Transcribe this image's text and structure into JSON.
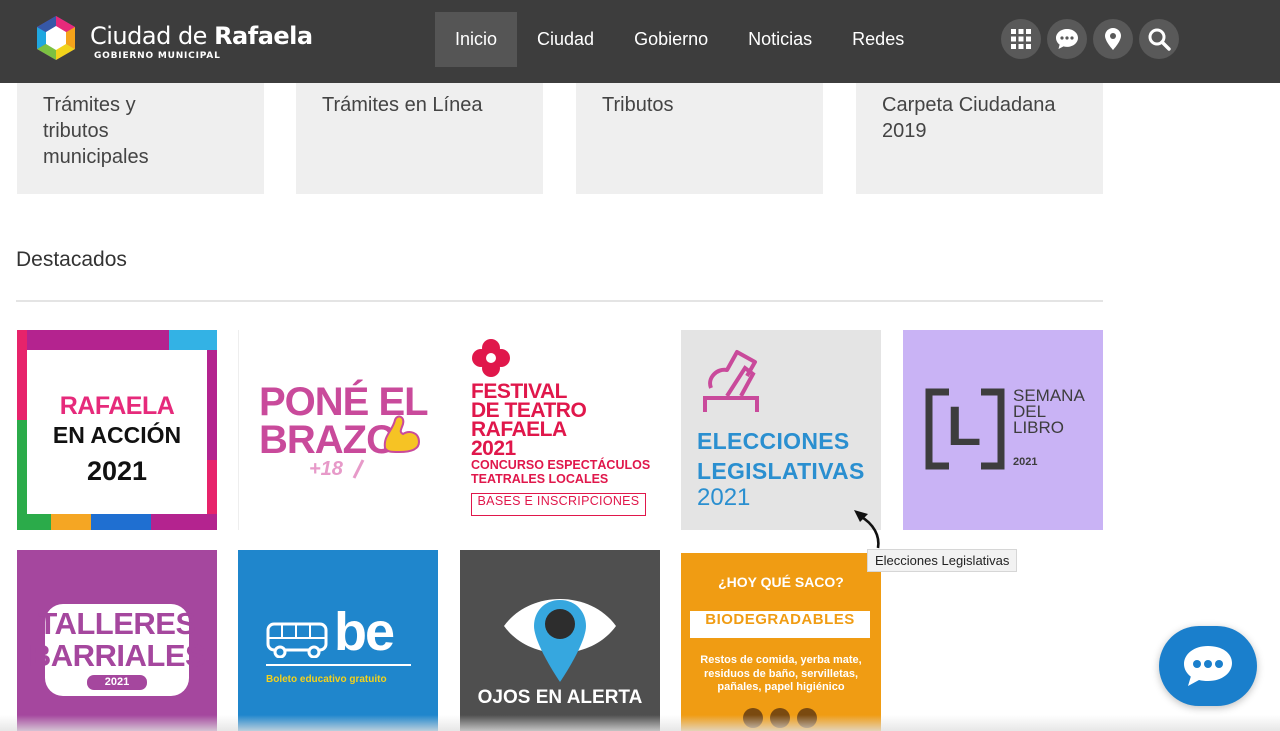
{
  "header": {
    "brand_line1_a": "Ciudad de ",
    "brand_line1_b": "Rafaela",
    "brand_line2": "GOBIERNO MUNICIPAL",
    "nav": [
      {
        "label": "Inicio",
        "active": true
      },
      {
        "label": "Ciudad"
      },
      {
        "label": "Gobierno"
      },
      {
        "label": "Noticias"
      },
      {
        "label": "Redes"
      }
    ],
    "icons": [
      "grid-icon",
      "chat-icon",
      "location-pin-icon",
      "search-icon"
    ]
  },
  "cards": [
    {
      "label": "Trámites y tributos municipales"
    },
    {
      "label": "Trámites en Línea"
    },
    {
      "label": "Tributos"
    },
    {
      "label": "Carpeta Ciudadana 2019"
    }
  ],
  "section": {
    "title": "Destacados"
  },
  "tiles": {
    "rafaela": {
      "l1": "RAFAELA",
      "l2": "EN ACCIÓN",
      "l3": "2021"
    },
    "pone": {
      "l1": "PONÉ EL",
      "l2": "BRAZO",
      "l3": "+18"
    },
    "festival": {
      "l1": "FESTIVAL",
      "l2": "DE TEATRO",
      "l3": "RAFAELA",
      "l4": "2021",
      "l5": "CONCURSO ESPECTÁCULOS",
      "l6": "TEATRALES LOCALES",
      "l7": "BASES E INSCRIPCIONES"
    },
    "elecciones": {
      "l1": "ELECCIONES",
      "l2": "LEGISLATIVAS",
      "l3": "2021"
    },
    "semana": {
      "l1": "SEMANA",
      "l2": "DEL",
      "l3": "LIBRO",
      "l4": "2021",
      "letter": "L"
    },
    "talleres": {
      "l1": "TALLERES",
      "l2": "BARRIALES",
      "l3": "2021"
    },
    "boleto": {
      "logo": "be",
      "caption": "Boleto educativo gratuito"
    },
    "ojos": {
      "caption": "OJOS EN ALERTA"
    },
    "saco": {
      "l1": "¿HOY QUÉ SACO?",
      "l2": "BIODEGRADABLES",
      "l3": "Restos de comida, yerba mate,",
      "l4": "residuos de baño, servilletas,",
      "l5": "pañales, papel higiénico"
    }
  },
  "tooltip": {
    "text": "Elecciones Legislativas"
  },
  "colors": {
    "header_bg": "#3d3d3d",
    "card_bg": "#efefef",
    "chat_blue": "#1a7fcc",
    "magenta": "#c2187a",
    "festival_red": "#e0174b",
    "elecciones_blue": "#2a8fd0",
    "semana_lilac": "#c9b3f5",
    "talleres_purple": "#a5479e",
    "boleto_blue": "#1f86cc",
    "ojos_gray": "#4f4f4f",
    "saco_orange": "#f09c13"
  }
}
